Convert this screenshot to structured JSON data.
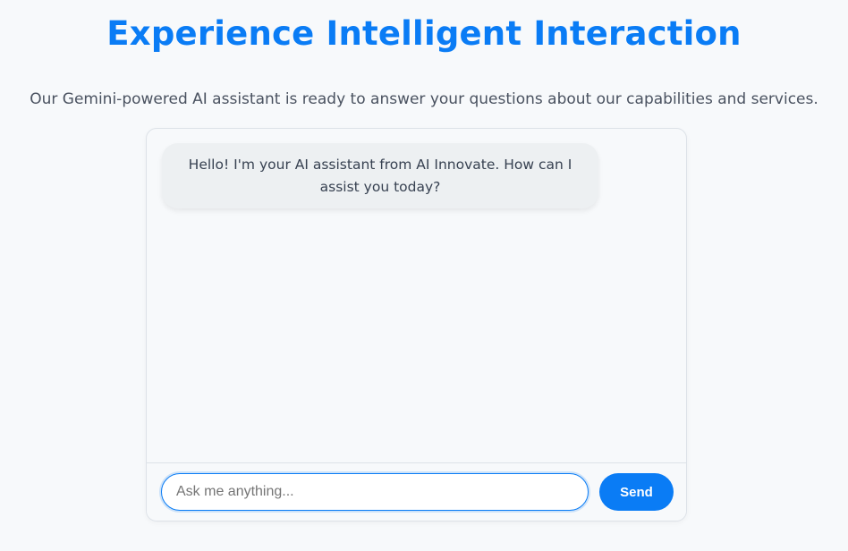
{
  "hero": {
    "title": "Experience Intelligent Interaction",
    "subtitle": "Our Gemini-powered AI assistant is ready to answer your questions about our capabilities and services."
  },
  "chat": {
    "messages": [
      {
        "sender": "assistant",
        "text": "Hello! I'm your AI assistant from AI Innovate. How can I assist you today?"
      }
    ],
    "input": {
      "value": "",
      "placeholder": "Ask me anything..."
    },
    "send_label": "Send"
  },
  "colors": {
    "accent": "#0a7cf5",
    "background": "#f7f9fb",
    "bubble": "#edf0f2",
    "text": "#374151"
  }
}
